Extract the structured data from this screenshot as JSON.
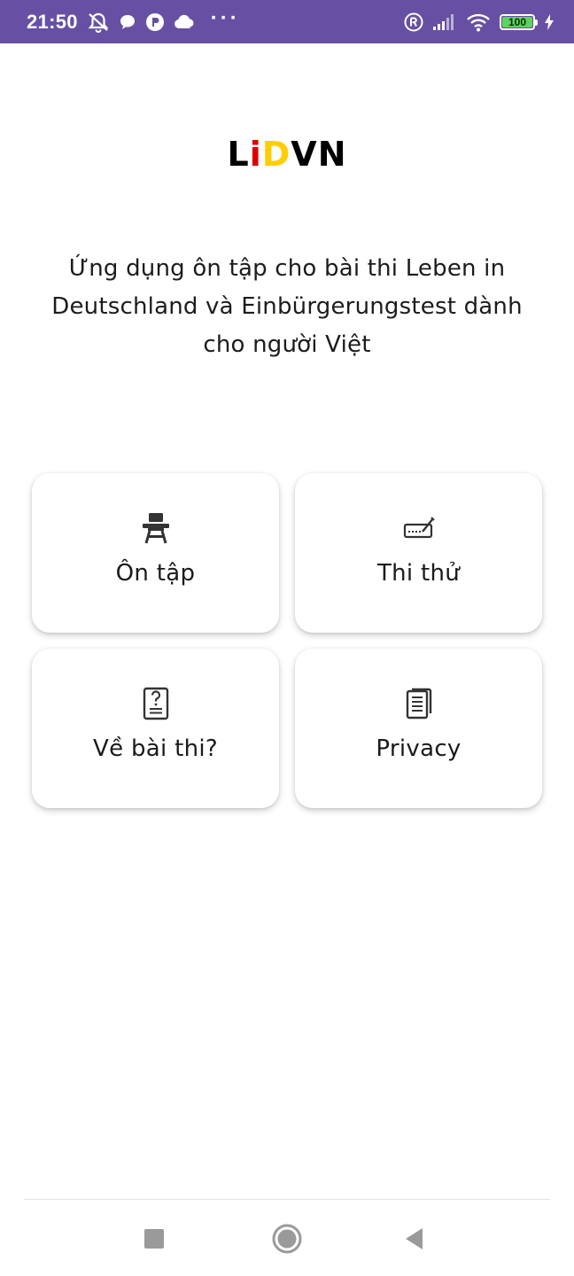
{
  "status_bar": {
    "time": "21:50",
    "more": "···",
    "battery_level": "100",
    "battery_color": "#5fd25f",
    "background_color": "#6750a4",
    "icons": [
      "alarm-off-icon",
      "chat-bubble-icon",
      "app-badge-icon",
      "cloud-icon",
      "registered-icon",
      "signal-icon",
      "wifi-icon",
      "battery-icon",
      "charging-icon"
    ]
  },
  "logo": {
    "letters": [
      {
        "char": "L",
        "color": "#000000"
      },
      {
        "char": "i",
        "color": "#dd0000"
      },
      {
        "char": "D",
        "color": "#ffce00"
      },
      {
        "char": "V",
        "color": "#000000"
      },
      {
        "char": "N",
        "color": "#000000"
      }
    ]
  },
  "subtitle": "Ứng dụng ôn tập cho bài thi Leben in Deutschland và Einbürgerungstest dành cho người Việt",
  "menu": {
    "items": [
      {
        "label": "Ôn tập",
        "icon": "school-desk-icon"
      },
      {
        "label": "Thi thử",
        "icon": "signature-icon"
      },
      {
        "label": "Về bài thi?",
        "icon": "question-document-icon"
      },
      {
        "label": "Privacy",
        "icon": "document-pages-icon"
      }
    ]
  },
  "nav": {
    "icons": [
      "recent-apps-icon",
      "home-icon",
      "back-icon"
    ]
  }
}
